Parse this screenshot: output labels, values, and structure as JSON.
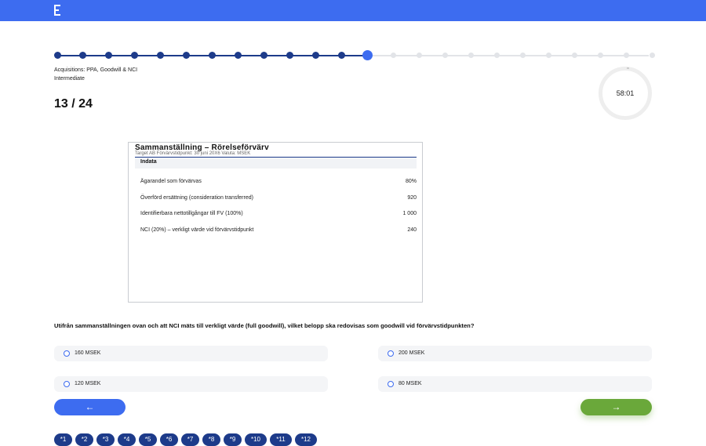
{
  "progress": {
    "current": 13,
    "total": 24
  },
  "meta": {
    "topic": "Acquisitions: PPA, Goodwill & NCI",
    "level": "Intermediate",
    "counter": "13 / 24"
  },
  "timer": {
    "time": "58:01"
  },
  "figure": {
    "title": "Sammanställning – Rörelseförvärv",
    "subtitle": "Target AB   Förvärvstidpunkt: 30 juni 20X6   Valuta: MSEK",
    "section": "Indata",
    "rows": [
      {
        "label": "Ägarandel som förvärvas",
        "value": "80%"
      },
      {
        "label": "Överförd ersättning (consideration transferred)",
        "value": "920"
      },
      {
        "label": "Identifierbara nettotillgångar till FV (100%)",
        "value": "1 000"
      },
      {
        "label": "NCI (20%) – verkligt värde vid förvärvstidpunkt",
        "value": "240"
      }
    ]
  },
  "question": {
    "text": "Utifrån sammanställningen ovan och att NCI mäts till verkligt värde (full goodwill), vilket belopp ska redovisas som goodwill vid förvärvstidpunkten?"
  },
  "options": [
    {
      "text": "160 MSEK"
    },
    {
      "text": "200 MSEK"
    },
    {
      "text": "120 MSEK"
    },
    {
      "text": "80 MSEK"
    }
  ],
  "nav": {
    "prev_label": "←",
    "next_label": "→"
  },
  "pager": [
    "*1",
    "*2",
    "*3",
    "*4",
    "*5",
    "*6",
    "*7",
    "*8",
    "*9",
    "*10",
    "*11",
    "*12"
  ],
  "colors": {
    "brand": "#3d6cf0",
    "done": "#1d3b8a",
    "next": "#6aa83a"
  }
}
